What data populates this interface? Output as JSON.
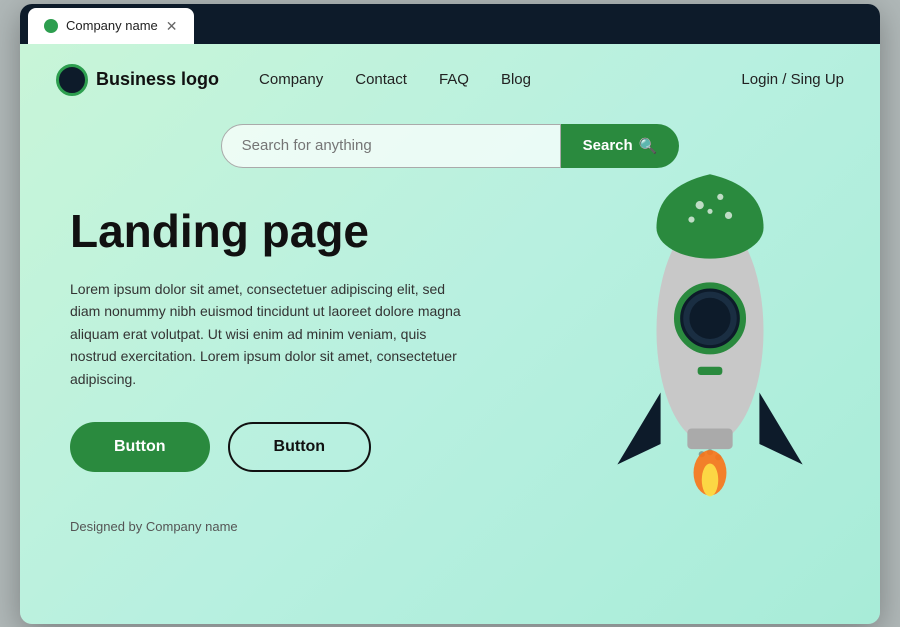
{
  "browser": {
    "tab_title": "Company name",
    "favicon_color": "#2d9e4f"
  },
  "navbar": {
    "logo_text": "Business logo",
    "nav_links": [
      {
        "label": "Company",
        "id": "company"
      },
      {
        "label": "Contact",
        "id": "contact"
      },
      {
        "label": "FAQ",
        "id": "faq"
      },
      {
        "label": "Blog",
        "id": "blog"
      }
    ],
    "auth_text": "Login / Sing Up"
  },
  "search": {
    "placeholder": "Search for anything",
    "button_label": "Search"
  },
  "hero": {
    "title": "Landing page",
    "body": "Lorem ipsum dolor sit amet, consectetuer adipiscing elit, sed diam nonummy nibh euismod tincidunt ut laoreet dolore magna aliquam erat volutpat. Ut wisi enim ad minim veniam, quis nostrud exercitation. Lorem ipsum dolor sit amet, consectetuer adipiscing.",
    "btn_primary_label": "Button",
    "btn_secondary_label": "Button"
  },
  "footer": {
    "text": "Designed by Company name"
  },
  "colors": {
    "accent_green": "#2a8a3e",
    "dark_navy": "#0d1b2a",
    "bg_gradient_start": "#c8f5d8"
  }
}
